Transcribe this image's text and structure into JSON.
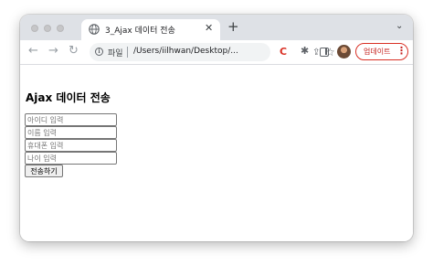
{
  "browser": {
    "tab": {
      "title": "3_Ajax 데이터 전송",
      "close_glyph": "✕"
    },
    "new_tab_glyph": "+",
    "tab_search_glyph": "⌄",
    "nav": {
      "back": "←",
      "forward": "→",
      "reload": "↻"
    },
    "address": {
      "scheme": "파일",
      "url": "/Users/iilhwan/Desktop/..."
    },
    "toolbar": {
      "update_label": "업데이트",
      "menu_glyph": "⋮",
      "extension_letter": "C",
      "share_glyph": "⇪",
      "star_glyph": "☆",
      "puzzle_glyph": "✱"
    },
    "icons": [
      "globe-icon",
      "info-icon",
      "share-icon",
      "star-icon",
      "extension-icon",
      "puzzle-icon",
      "side-panel-icon",
      "avatar",
      "kebab-menu-icon"
    ]
  },
  "page": {
    "title": "Ajax 데이터 전송",
    "fields": [
      {
        "placeholder": "아이디 입력",
        "value": ""
      },
      {
        "placeholder": "이름 입력",
        "value": ""
      },
      {
        "placeholder": "휴대폰 입력",
        "value": ""
      },
      {
        "placeholder": "나이 입력",
        "value": ""
      }
    ],
    "submit_label": "전송하기"
  },
  "colors": {
    "tabstrip": "#dee1e6",
    "update_accent": "#d93025",
    "omnibox": "#f1f3f4"
  }
}
